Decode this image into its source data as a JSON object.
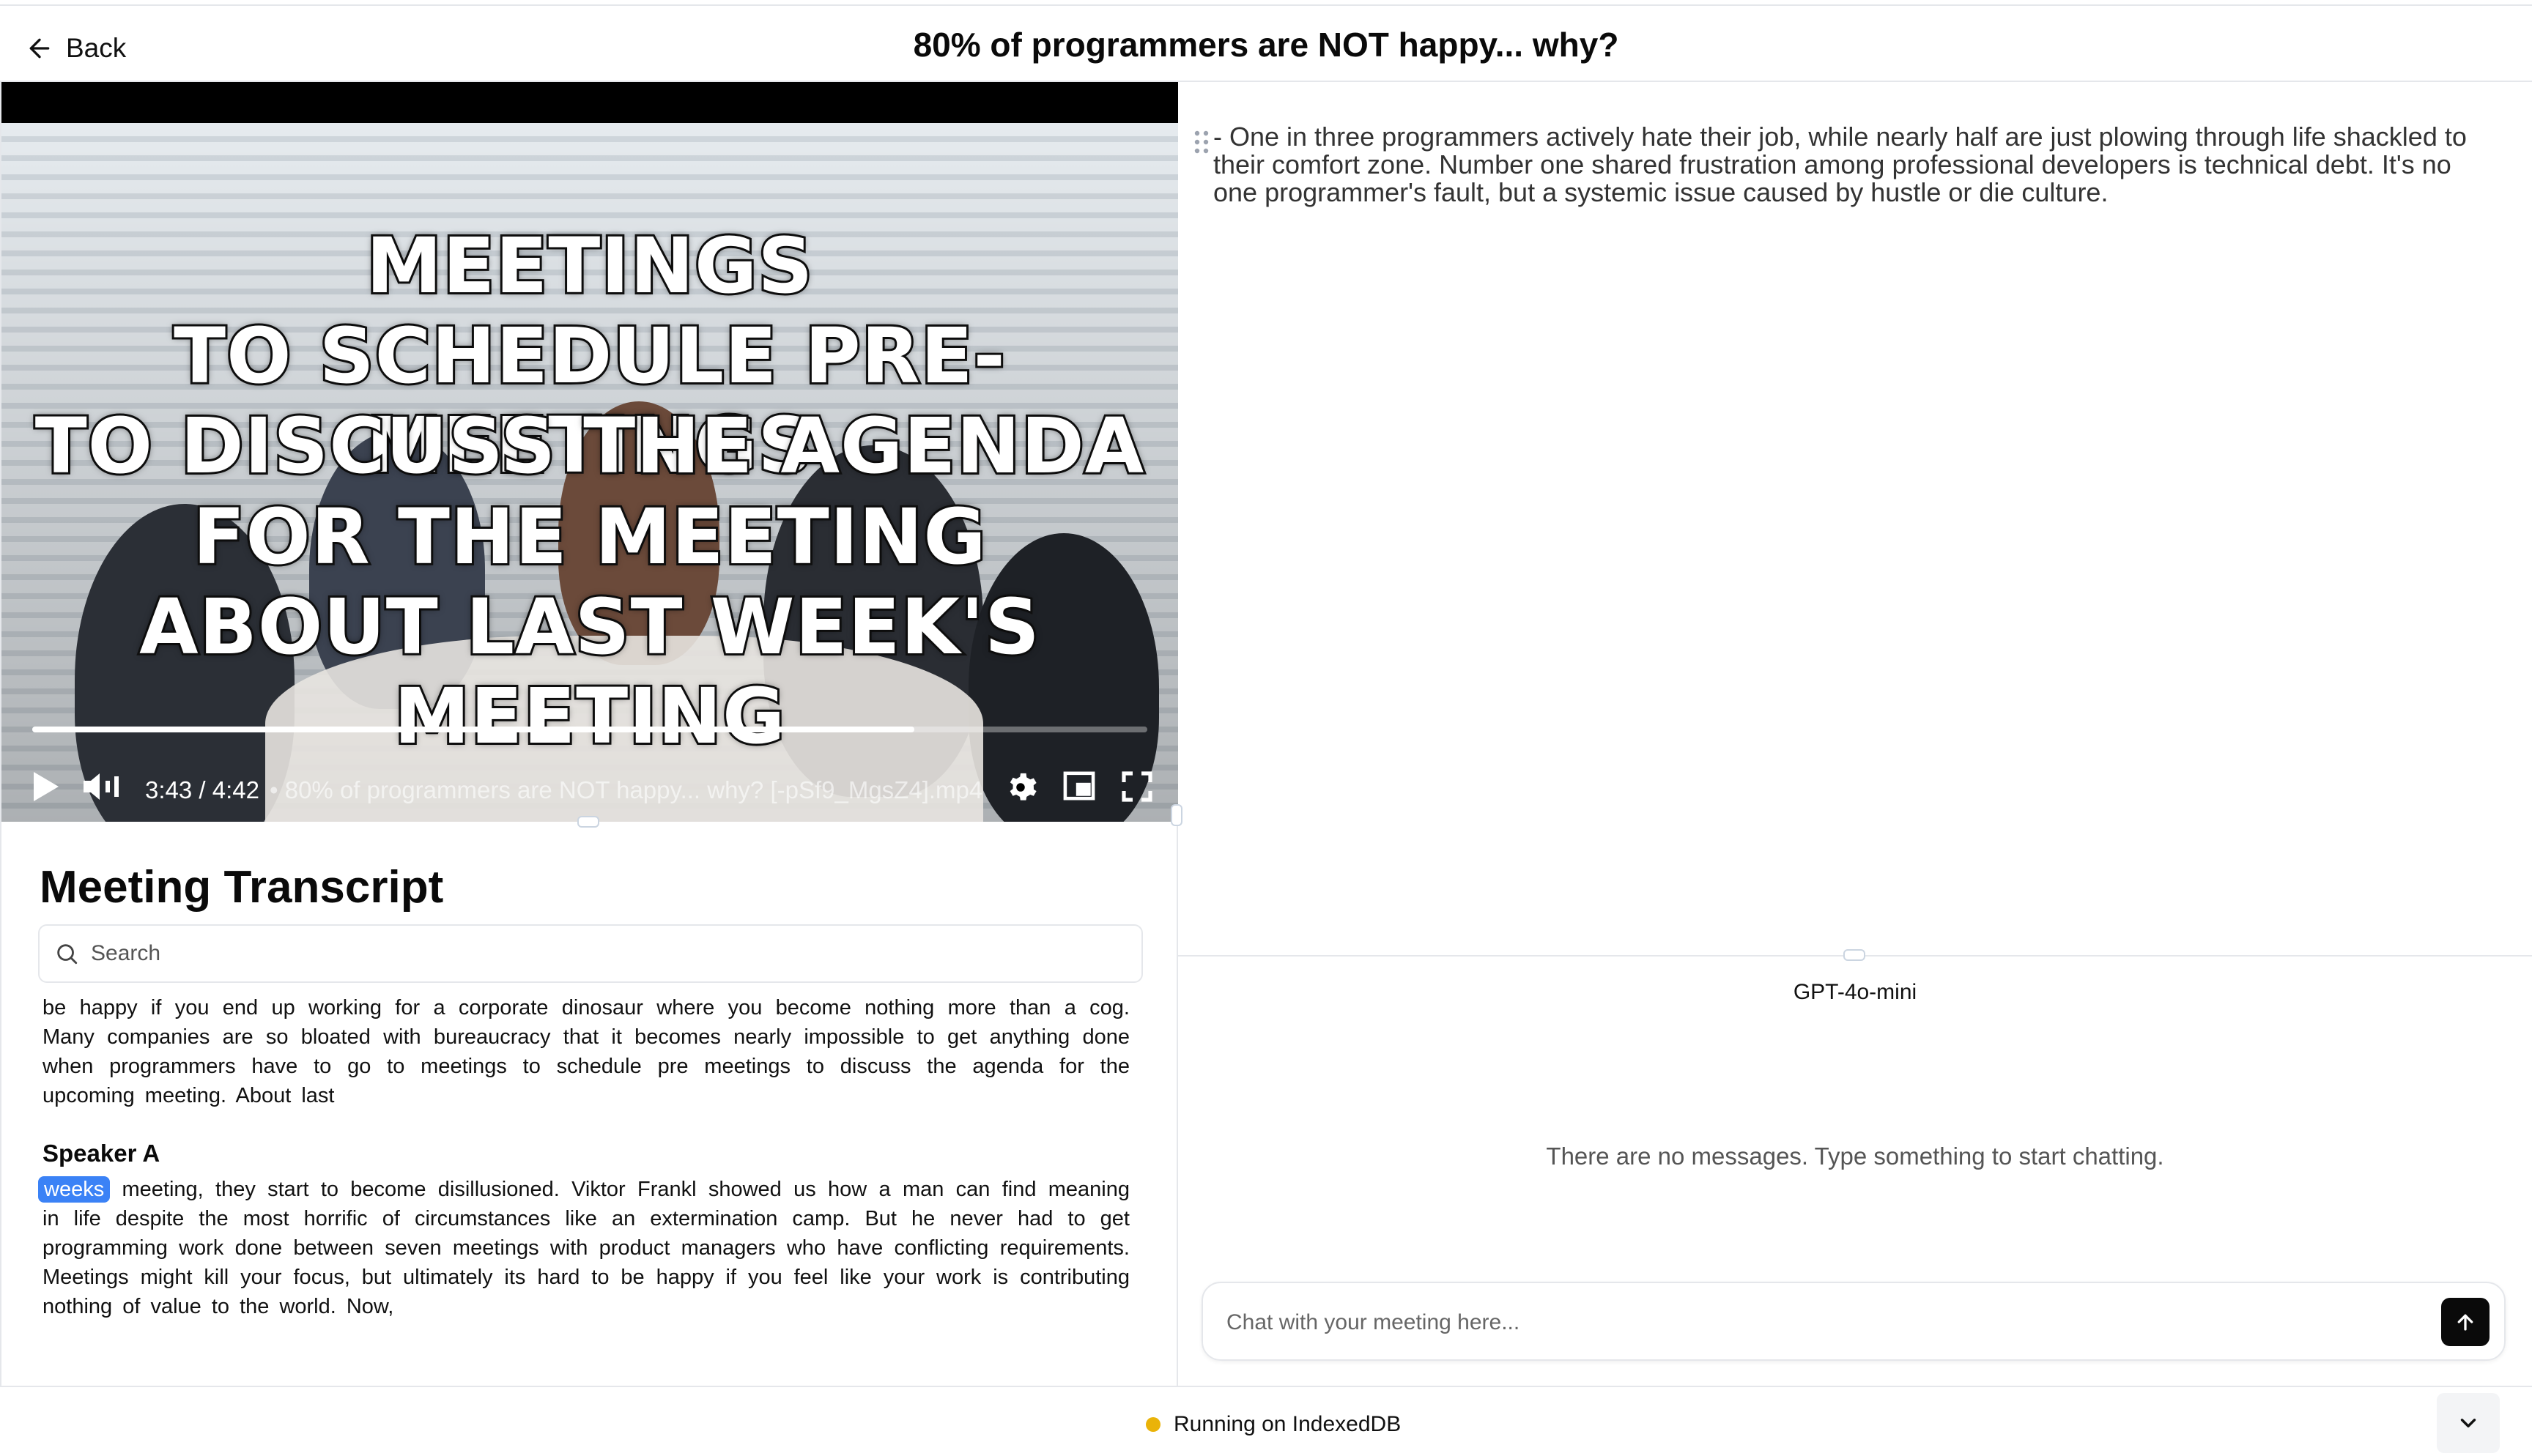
{
  "header": {
    "back_label": "Back",
    "title": "80% of programmers are NOT happy... why?"
  },
  "video": {
    "overlay_lines": [
      "MEETINGS",
      "TO SCHEDULE PRE-MEETINGS",
      "TO DISCUSS THE AGENDA",
      "FOR THE MEETING",
      "ABOUT LAST WEEK'S MEETING"
    ],
    "current_time": "3:43",
    "duration": "4:42",
    "time_display": "3:43 / 4:42",
    "file_label": "•  80% of programmers are NOT happy... why?  [-pSf9_MgsZ4].mp4",
    "progress_fraction": 0.791,
    "icons": [
      "play-icon",
      "volume-icon",
      "settings-icon",
      "picture-in-picture-icon",
      "fullscreen-icon"
    ]
  },
  "transcript": {
    "title": "Meeting Transcript",
    "search_placeholder": "Search",
    "paragraph_1": "be happy if you end up working for a corporate dinosaur where you become nothing more than a cog. Many companies are so bloated with bureaucracy that it becomes nearly impossible to get anything done when programmers have to go to meetings to schedule pre meetings to discuss the agenda for the upcoming meeting. About last",
    "speaker": "Speaker A",
    "highlighted_word": "weeks",
    "paragraph_2": "meeting, they start to become disillusioned. Viktor Frankl showed us how a man can find meaning in life despite the most horrific of circumstances like an extermination camp. But he never had to get programming work done between seven meetings with product managers who have conflicting requirements. Meetings might kill your focus, but ultimately its hard to be happy if you feel like your work is contributing nothing of value to the world. Now,"
  },
  "summary": {
    "text": "- One in three programmers actively hate their job, while nearly half are just plowing through life shackled to their comfort zone. Number one shared frustration among professional developers is technical debt. It's no one programmer's fault, but a systemic issue caused by hustle or die culture."
  },
  "chat": {
    "model": "GPT-4o-mini",
    "empty_message": "There are no messages. Type something to start chatting.",
    "input_placeholder": "Chat with your meeting here..."
  },
  "footer": {
    "status_text": "Running on IndexedDB",
    "status_color": "#eab308"
  }
}
